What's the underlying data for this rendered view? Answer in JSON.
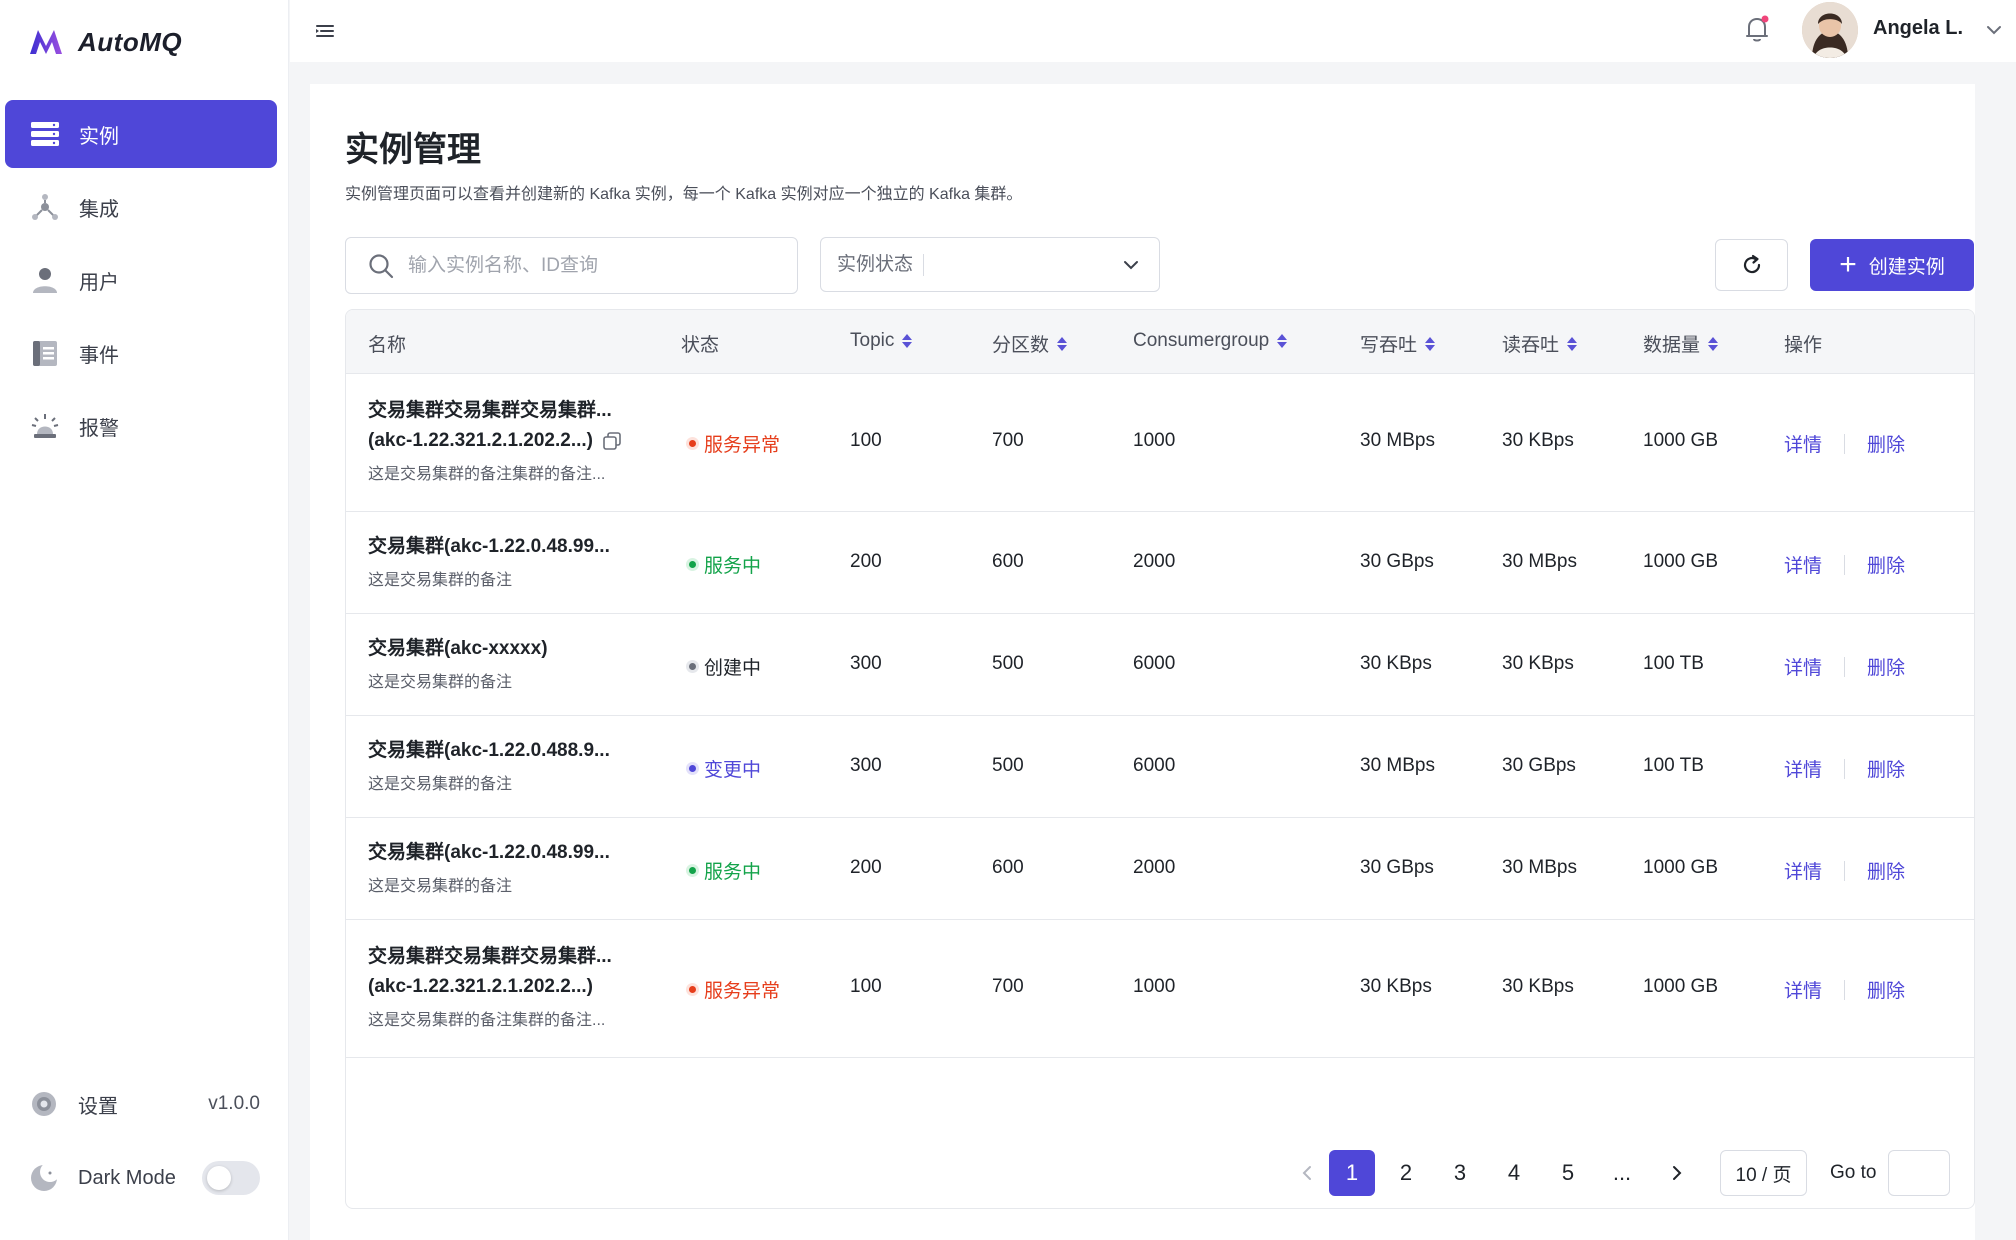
{
  "app": {
    "name": "AutoMQ",
    "accent": "#4f47d8"
  },
  "sidebar": {
    "items": [
      {
        "label": "实例",
        "icon": "server-icon",
        "active": true
      },
      {
        "label": "集成",
        "icon": "integration-icon",
        "active": false
      },
      {
        "label": "用户",
        "icon": "user-icon",
        "active": false
      },
      {
        "label": "事件",
        "icon": "event-list-icon",
        "active": false
      },
      {
        "label": "报警",
        "icon": "alarm-icon",
        "active": false
      }
    ],
    "settings": {
      "label": "设置",
      "version": "v1.0.0"
    },
    "dark_mode": {
      "label": "Dark Mode",
      "enabled": false
    }
  },
  "topbar": {
    "user_name": "Angela L.",
    "has_notification": true
  },
  "page": {
    "title": "实例管理",
    "description": "实例管理页面可以查看并创建新的 Kafka 实例，每一个 Kafka 实例对应一个独立的 Kafka 集群。"
  },
  "filters": {
    "search_placeholder": "输入实例名称、ID查询",
    "status_placeholder": "实例状态",
    "create_label": "创建实例"
  },
  "table": {
    "columns": [
      "名称",
      "状态",
      "Topic",
      "分区数",
      "Consumergroup",
      "写吞吐",
      "读吞吐",
      "数据量",
      "操作"
    ],
    "sortable": [
      false,
      false,
      true,
      true,
      true,
      true,
      true,
      true,
      false
    ],
    "rows": [
      {
        "name_line1": "交易集群交易集群交易集群...",
        "name_line2": "(akc-1.22.321.2.1.202.2...)",
        "remark": "这是交易集群的备注集群的备注...",
        "status": "服务异常",
        "status_type": "err",
        "topic": "100",
        "partitions": "700",
        "consumergroup": "1000",
        "write": "30 MBps",
        "read": "30 KBps",
        "data": "1000 GB",
        "detail": "详情",
        "delete": "删除"
      },
      {
        "name_line1": "交易集群(akc-1.22.0.48.99...",
        "remark": "这是交易集群的备注",
        "status": "服务中",
        "status_type": "ok",
        "topic": "200",
        "partitions": "600",
        "consumergroup": "2000",
        "write": "30 GBps",
        "read": "30 MBps",
        "data": "1000 GB",
        "detail": "详情",
        "delete": "删除"
      },
      {
        "name_line1": "交易集群(akc-xxxxx)",
        "remark": "这是交易集群的备注",
        "status": "创建中",
        "status_type": "crt",
        "topic": "300",
        "partitions": "500",
        "consumergroup": "6000",
        "write": "30 KBps",
        "read": "30 KBps",
        "data": "100 TB",
        "detail": "详情",
        "delete": "删除"
      },
      {
        "name_line1": "交易集群(akc-1.22.0.488.9...",
        "remark": "这是交易集群的备注",
        "status": "变更中",
        "status_type": "chg",
        "topic": "300",
        "partitions": "500",
        "consumergroup": "6000",
        "write": "30 MBps",
        "read": "30 GBps",
        "data": "100 TB",
        "detail": "详情",
        "delete": "删除"
      },
      {
        "name_line1": "交易集群(akc-1.22.0.48.99...",
        "remark": "这是交易集群的备注",
        "status": "服务中",
        "status_type": "ok",
        "topic": "200",
        "partitions": "600",
        "consumergroup": "2000",
        "write": "30 GBps",
        "read": "30 MBps",
        "data": "1000 GB",
        "detail": "详情",
        "delete": "删除"
      },
      {
        "name_line1": "交易集群交易集群交易集群...",
        "name_line2": "(akc-1.22.321.2.1.202.2...)",
        "remark": "这是交易集群的备注集群的备注...",
        "status": "服务异常",
        "status_type": "err",
        "topic": "100",
        "partitions": "700",
        "consumergroup": "1000",
        "write": "30 KBps",
        "read": "30 KBps",
        "data": "1000 GB",
        "detail": "详情",
        "delete": "删除"
      }
    ]
  },
  "pagination": {
    "pages": [
      "1",
      "2",
      "3",
      "4",
      "5",
      "..."
    ],
    "current": "1",
    "page_size": "10 / 页",
    "goto_label": "Go to"
  }
}
